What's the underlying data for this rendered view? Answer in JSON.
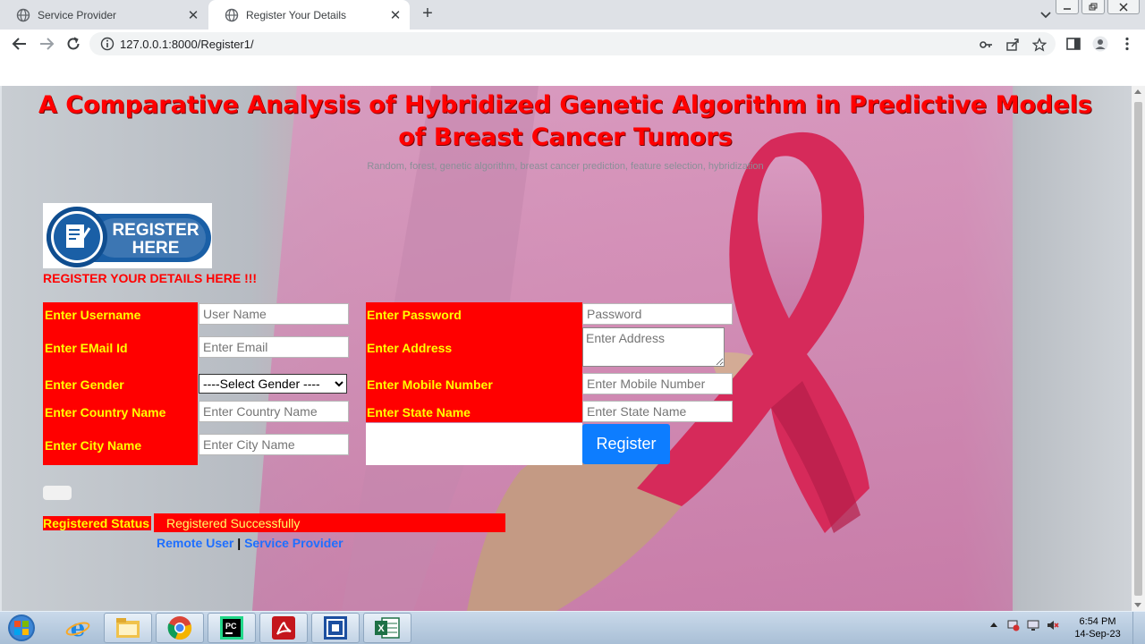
{
  "browser": {
    "tabs": [
      {
        "title": "Service Provider",
        "active": false
      },
      {
        "title": "Register Your Details",
        "active": true
      }
    ],
    "new_tab_label": "+",
    "close_glyph": "✕",
    "url": "127.0.0.1:8000/Register1/"
  },
  "page": {
    "title": "A Comparative Analysis of Hybridized Genetic Algorithm in Predictive Models of Breast Cancer Tumors",
    "keywords": "Random, forest, genetic algorithm, breast cancer prediction, feature selection, hybridization",
    "logo": {
      "line1": "REGISTER",
      "line2": "HERE"
    },
    "heading": "REGISTER YOUR DETAILS HERE !!!",
    "form": {
      "username": {
        "label": "Enter Username",
        "placeholder": "User Name"
      },
      "email": {
        "label": "Enter EMail Id",
        "placeholder": "Enter Email"
      },
      "gender": {
        "label": "Enter Gender",
        "selected": "----Select Gender ----"
      },
      "country": {
        "label": "Enter Country Name",
        "placeholder": "Enter Country Name"
      },
      "city": {
        "label": "Enter City Name",
        "placeholder": "Enter City Name"
      },
      "password": {
        "label": "Enter Password",
        "placeholder": "Password"
      },
      "address": {
        "label": "Enter Address",
        "placeholder": "Enter Address"
      },
      "mobile": {
        "label": "Enter Mobile Number",
        "placeholder": "Enter Mobile Number"
      },
      "state": {
        "label": "Enter State Name",
        "placeholder": "Enter State Name"
      },
      "register_button": "Register"
    },
    "status": {
      "label": "Registered Status",
      "value": "Registered Successfully"
    },
    "links": {
      "remote_user": "Remote User",
      "separator": "|",
      "service_provider": "Service Provider"
    }
  },
  "taskbar": {
    "time": "6:54 PM",
    "date": "14-Sep-23",
    "apps": [
      "internet-explorer",
      "file-explorer",
      "chrome",
      "pycharm",
      "acrobat",
      "remote-desktop",
      "excel"
    ]
  },
  "colors": {
    "title_red": "#ff0000",
    "form_red": "#ff0000",
    "label_yellow": "#ffff00",
    "register_blue": "#0d7dff",
    "link_blue": "#1f6fff",
    "ribbon_pink": "#d62a5a"
  }
}
